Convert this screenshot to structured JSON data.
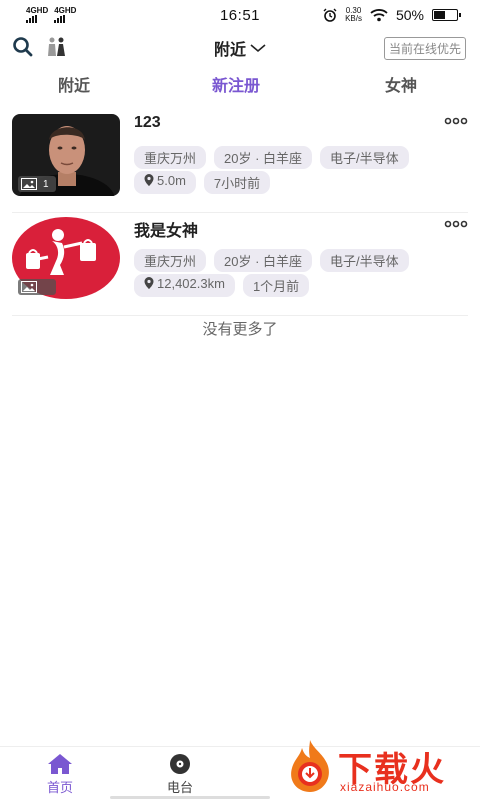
{
  "status_bar": {
    "sim1": "4GHD",
    "sim2": "4GHD",
    "time": "16:51",
    "speed_value": "0.30",
    "speed_unit": "KB/s",
    "battery": "50%"
  },
  "header": {
    "title": "附近",
    "online_button": "当前在线优先"
  },
  "tabs": [
    {
      "label": "附近",
      "active": false
    },
    {
      "label": "新注册",
      "active": true
    },
    {
      "label": "女神",
      "active": false
    }
  ],
  "users": [
    {
      "name": "123",
      "photo_count": "1",
      "location": "重庆万州",
      "age_sign": "20岁 · 白羊座",
      "industry": "电子/半导体",
      "distance": "5.0m",
      "last_active": "7小时前"
    },
    {
      "name": "我是女神",
      "photo_count": "",
      "location": "重庆万州",
      "age_sign": "20岁 · 白羊座",
      "industry": "电子/半导体",
      "distance": "12,402.3km",
      "last_active": "1个月前"
    }
  ],
  "list_end_text": "没有更多了",
  "bottom_nav": [
    {
      "label": "首页",
      "icon": "home-icon",
      "active": true
    },
    {
      "label": "电台",
      "icon": "radio-icon",
      "active": false
    }
  ],
  "watermark": {
    "title": "下载火",
    "url": "xiazaihuo.com"
  },
  "colors": {
    "accent": "#7a57d1",
    "tag_bg": "#eceaf2",
    "watermark": "#e8301e"
  }
}
